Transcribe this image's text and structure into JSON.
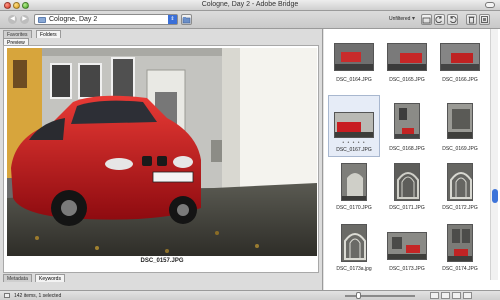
{
  "window": {
    "title": "Cologne, Day 2 - Adobe Bridge"
  },
  "toolbar": {
    "path_value": "Cologne, Day 2",
    "sort_label": "Unfiltered",
    "icons": [
      "back-arrow-icon",
      "forward-arrow-icon",
      "folder-icon",
      "new-folder-icon",
      "rotate-left-icon",
      "rotate-right-icon",
      "trash-icon",
      "open-in-icon"
    ]
  },
  "left_panel": {
    "top_tabs": [
      "Favorites",
      "Folders"
    ],
    "preview_tab": "Preview",
    "preview_caption": "DSC_0157.JPG",
    "bottom_tabs": [
      "Metadata",
      "Keywords"
    ]
  },
  "thumbnails": [
    {
      "label": "DSC_0164.JPG"
    },
    {
      "label": "DSC_0165.JPG"
    },
    {
      "label": "DSC_0166.JPG"
    },
    {
      "label": "DSC_0167.JPG",
      "selected": true,
      "rating": "• • • • •"
    },
    {
      "label": "DSC_0168.JPG"
    },
    {
      "label": "DSC_0169.JPG"
    },
    {
      "label": "DSC_0170.JPG"
    },
    {
      "label": "DSC_0171.JPG"
    },
    {
      "label": "DSC_0172.JPG"
    },
    {
      "label": "DSC_0173a.jpg"
    },
    {
      "label": "DSC_0173.JPG"
    },
    {
      "label": "DSC_0174.JPG"
    }
  ],
  "status": {
    "text": "142 items, 1 selected"
  },
  "colors": {
    "accent_blue": "#3d74d9",
    "car_red": "#d0161d",
    "selection_bg": "#e6ecf7"
  }
}
